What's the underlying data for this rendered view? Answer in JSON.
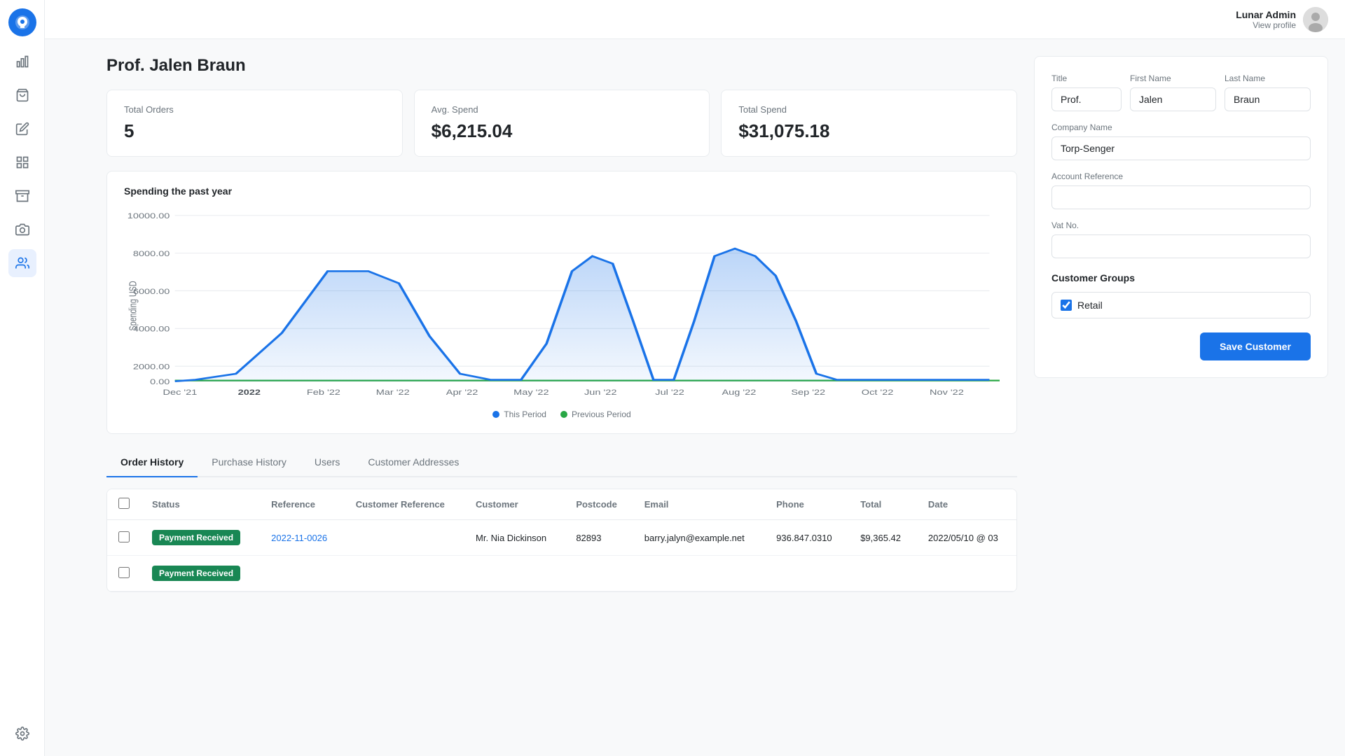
{
  "app": {
    "name": "Lunar Admin",
    "view_profile": "View profile"
  },
  "page": {
    "title": "Prof. Jalen Braun"
  },
  "stats": {
    "total_orders_label": "Total Orders",
    "total_orders_value": "5",
    "avg_spend_label": "Avg. Spend",
    "avg_spend_value": "$6,215.04",
    "total_spend_label": "Total Spend",
    "total_spend_value": "$31,075.18"
  },
  "chart": {
    "title": "Spending the past year",
    "y_axis_label": "Spending USD",
    "legend": {
      "this_period": "This Period",
      "previous_period": "Previous Period"
    },
    "x_labels": [
      "Dec '21",
      "2022",
      "Feb '22",
      "Mar '22",
      "Apr '22",
      "May '22",
      "Jun '22",
      "Jul '22",
      "Aug '22",
      "Sep '22",
      "Oct '22",
      "Nov '22"
    ],
    "y_labels": [
      "0.00",
      "2000.00",
      "4000.00",
      "6000.00",
      "8000.00",
      "10000.00"
    ]
  },
  "tabs": [
    {
      "label": "Order History",
      "active": true
    },
    {
      "label": "Purchase History",
      "active": false
    },
    {
      "label": "Users",
      "active": false
    },
    {
      "label": "Customer Addresses",
      "active": false
    }
  ],
  "table": {
    "columns": [
      "Status",
      "Reference",
      "Customer Reference",
      "Customer",
      "Postcode",
      "Email",
      "Phone",
      "Total",
      "Date"
    ],
    "rows": [
      {
        "status": "Payment Received",
        "status_class": "badge-payment-received",
        "reference": "2022-11-0026",
        "customer_reference": "",
        "customer": "Mr. Nia Dickinson",
        "postcode": "82893",
        "email": "barry.jalyn@example.net",
        "phone": "936.847.0310",
        "total": "$9,365.42",
        "date": "2022/05/10 @ 03"
      }
    ]
  },
  "form": {
    "title_label": "Title",
    "title_value": "Prof.",
    "first_name_label": "First Name",
    "first_name_value": "Jalen",
    "last_name_label": "Last Name",
    "last_name_value": "Braun",
    "company_name_label": "Company Name",
    "company_name_value": "Torp-Senger",
    "account_reference_label": "Account Reference",
    "account_reference_value": "",
    "vat_no_label": "Vat No.",
    "vat_no_value": "",
    "customer_groups_label": "Customer Groups",
    "group_retail_label": "Retail",
    "group_retail_checked": true,
    "save_button_label": "Save Customer"
  },
  "sidebar": {
    "icons": [
      {
        "name": "chart-icon",
        "symbol": "📊",
        "active": false
      },
      {
        "name": "shopping-icon",
        "symbol": "🛍",
        "active": false
      },
      {
        "name": "edit-icon",
        "symbol": "✏️",
        "active": false
      },
      {
        "name": "grid-icon",
        "symbol": "⊞",
        "active": false
      },
      {
        "name": "archive-icon",
        "symbol": "🗃",
        "active": false
      },
      {
        "name": "camera-icon",
        "symbol": "📷",
        "active": false
      },
      {
        "name": "users-icon",
        "symbol": "👥",
        "active": true
      },
      {
        "name": "settings-icon",
        "symbol": "⚙️",
        "active": false
      }
    ]
  }
}
